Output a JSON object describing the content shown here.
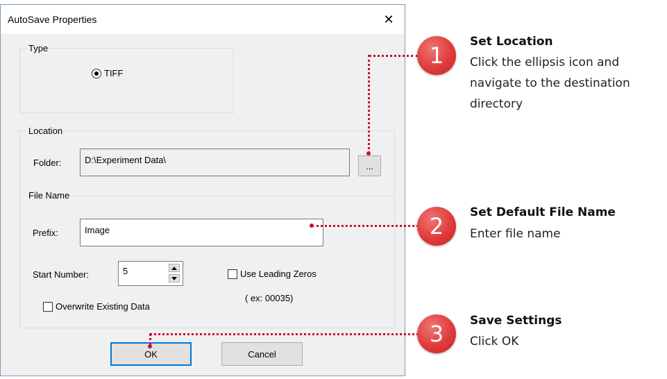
{
  "dialog": {
    "title": "AutoSave Properties",
    "close_glyph": "✕",
    "type_group": {
      "label": "Type",
      "radio_label": "TIFF",
      "selected": true
    },
    "location_group": {
      "label": "Location",
      "folder_label": "Folder:",
      "folder_value": "D:\\Experiment Data\\",
      "browse_label": "..."
    },
    "file_name_group": {
      "label": "File Name",
      "prefix_label": "Prefix:",
      "prefix_value": "Image",
      "start_number_label": "Start Number:",
      "start_number_value": "5",
      "leading_zeros_label": "Use Leading Zeros",
      "leading_zeros_checked": false,
      "leading_zeros_example": "( ex: 00035)",
      "overwrite_label": "Overwrite Existing Data",
      "overwrite_checked": false
    },
    "ok_label": "OK",
    "cancel_label": "Cancel"
  },
  "callouts": [
    {
      "number": "1",
      "title": "Set Location",
      "description": "Click the ellipsis icon and navigate to the destination directory"
    },
    {
      "number": "2",
      "title": "Set Default File Name",
      "description": "Enter file name"
    },
    {
      "number": "3",
      "title": "Save Settings",
      "description": "Click OK"
    }
  ],
  "colors": {
    "accent": "#e03b3b",
    "connector": "#c8102e",
    "focus": "#0078d7"
  },
  "icons": {
    "close": "close-icon",
    "spin_up": "arrow-up-icon",
    "spin_down": "arrow-down-icon"
  }
}
